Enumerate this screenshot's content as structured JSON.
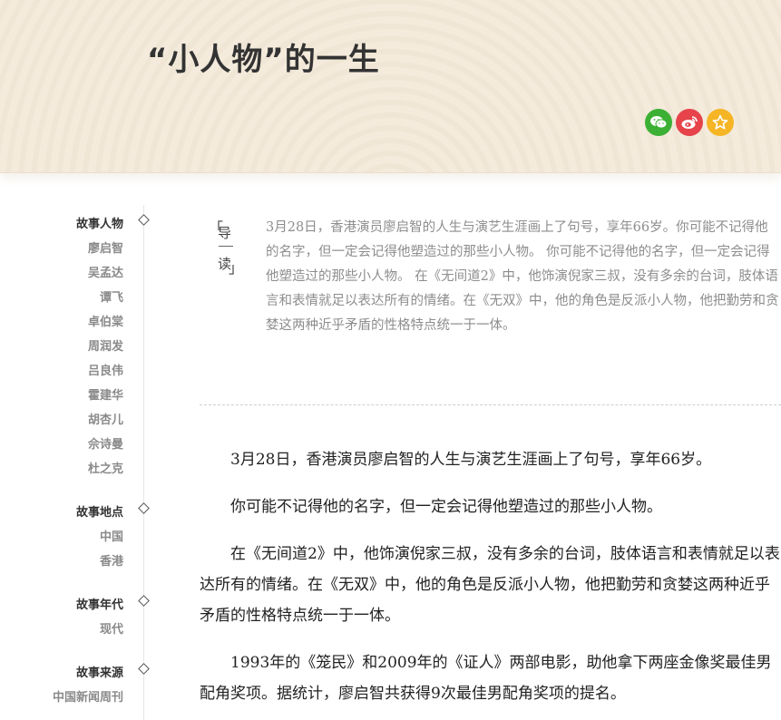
{
  "header": {
    "title": "“小人物”的一生",
    "share": {
      "wechat_icon": "wechat-icon",
      "weibo_icon": "weibo-icon",
      "favorite_icon": "star-icon",
      "colors": {
        "wechat": "#3cb034",
        "weibo": "#e6434b",
        "favorite": "#f5b524"
      }
    }
  },
  "sidebar": {
    "groups": [
      {
        "title": "故事人物",
        "items": [
          "廖启智",
          "吴孟达",
          "谭飞",
          "卓伯棠",
          "周润发",
          "吕良伟",
          "霍建华",
          "胡杏儿",
          "佘诗曼",
          "杜之克"
        ]
      },
      {
        "title": "故事地点",
        "items": [
          "中国",
          "香港"
        ]
      },
      {
        "title": "故事年代",
        "items": [
          "现代"
        ]
      },
      {
        "title": "故事来源",
        "items": [
          "中国新闻周刊"
        ]
      }
    ]
  },
  "intro": {
    "label_top": "导",
    "label_bottom": "读",
    "bracket_open": "「",
    "bracket_close": "」",
    "text": "3月28日，香港演员廖启智的人生与演艺生涯画上了句号，享年66岁。你可能不记得他的名字，但一定会记得他塑造过的那些小人物。 你可能不记得他的名字，但一定会记得他塑造过的那些小人物。 在《无间道2》中，他饰演倪家三叔，没有多余的台词，肢体语言和表情就足以表达所有的情绪。在《无双》中，他的角色是反派小人物，他把勤劳和贪婪这两种近乎矛盾的性格特点统一于一体。"
  },
  "article": {
    "paragraphs": [
      "3月28日，香港演员廖启智的人生与演艺生涯画上了句号，享年66岁。",
      "你可能不记得他的名字，但一定会记得他塑造过的那些小人物。",
      "在《无间道2》中，他饰演倪家三叔，没有多余的台词，肢体语言和表情就足以表达所有的情绪。在《无双》中，他的角色是反派小人物，他把勤劳和贪婪这两种近乎矛盾的性格特点统一于一体。",
      "1993年的《笼民》和2009年的《证人》两部电影，助他拿下两座金像奖最佳男配角奖项。据统计，廖启智共获得9次最佳男配角奖项的提名。"
    ]
  }
}
